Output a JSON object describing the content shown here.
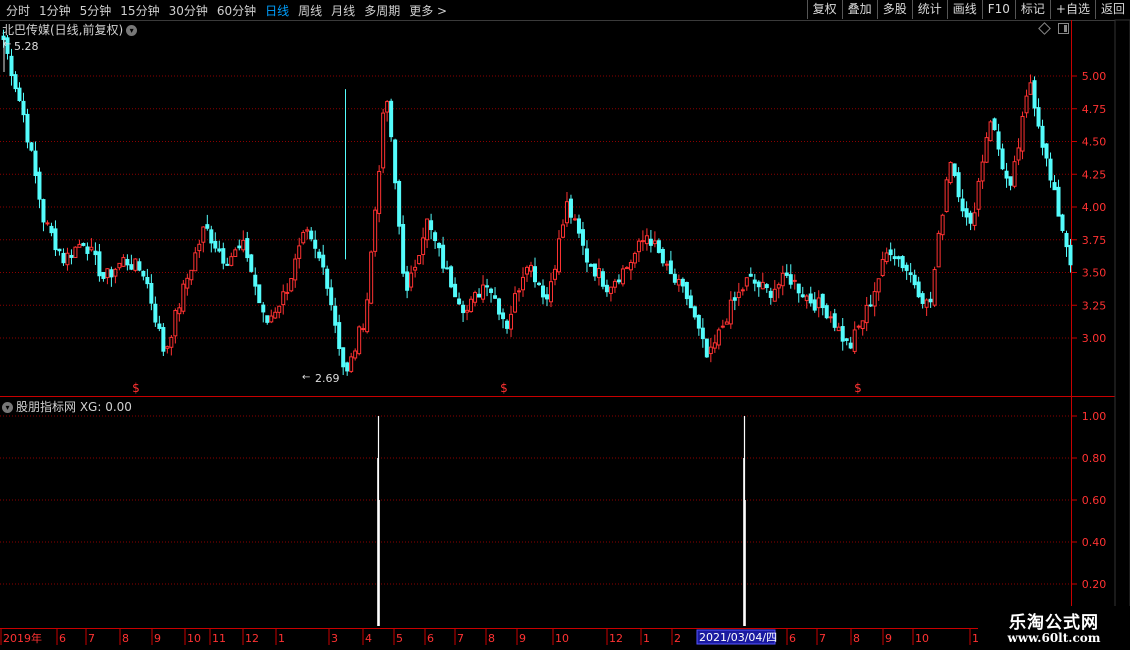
{
  "toolbar": {
    "periods": [
      "分时",
      "1分钟",
      "5分钟",
      "15分钟",
      "30分钟",
      "60分钟",
      "日线",
      "周线",
      "月线",
      "多周期",
      "更多 >"
    ],
    "active": "日线",
    "right_buttons": [
      "复权",
      "叠加",
      "多股",
      "统计",
      "画线",
      "F10",
      "标记",
      "+自选",
      "返回"
    ]
  },
  "chart": {
    "title": "北巴传媒(日线,前复权)",
    "high_label": "5.28",
    "low_label": "2.69",
    "price_ticks": [
      "5.00",
      "4.75",
      "4.50",
      "4.25",
      "4.00",
      "3.75",
      "3.50",
      "3.25",
      "3.00"
    ],
    "signal_marker": "$"
  },
  "indicator": {
    "title": "股朋指标网 XG: 0.00",
    "ticks": [
      "1.00",
      "0.80",
      "0.60",
      "0.40",
      "0.20"
    ]
  },
  "xaxis": {
    "labels": [
      "2019年",
      "6",
      "7",
      "8",
      "9",
      "10",
      "11",
      "12",
      "1",
      "3",
      "4",
      "5",
      "6",
      "7",
      "8",
      "9",
      "10",
      "12",
      "1",
      "2",
      "6",
      "7",
      "8",
      "9",
      "10",
      "1"
    ],
    "cursor_date": "2021/03/04/四"
  },
  "watermark": {
    "line1": "乐淘公式网",
    "line2": "www.60lt.com"
  },
  "colors": {
    "up": "#ff3232",
    "down": "#54fcfc",
    "grid": "#8b0000",
    "axis": "#c80000",
    "indicator_line": "#ffffff"
  },
  "chart_data": {
    "type": "candlestick",
    "title": "北巴传媒(日线,前复权)",
    "series": [
      {
        "name": "",
        "values": [
          5.28,
          4.7,
          3.9,
          3.6,
          3.75,
          3.45,
          3.6,
          3.5,
          2.88,
          3.4,
          3.85,
          3.6,
          3.7,
          3.1,
          3.35,
          3.8,
          3.5,
          2.69,
          3.2,
          4.9,
          3.3,
          3.9,
          3.5,
          3.2,
          3.45,
          3.1,
          3.6,
          3.3,
          4.02,
          3.6,
          3.4,
          3.55,
          3.8,
          3.5,
          3.3,
          2.82,
          3.2,
          3.45,
          3.35,
          3.47,
          3.3,
          3.2,
          2.92,
          3.25,
          3.7,
          3.5,
          3.22,
          4.4,
          3.8,
          4.7,
          4.1,
          4.97,
          4.2,
          3.6
        ]
      }
    ],
    "ylim": [
      2.69,
      5.28
    ],
    "indicator": {
      "name": "XG",
      "current": 0.0,
      "signals": [
        1,
        1
      ],
      "signal_dates": [
        "2020年4月",
        "2021/03/04"
      ]
    }
  }
}
